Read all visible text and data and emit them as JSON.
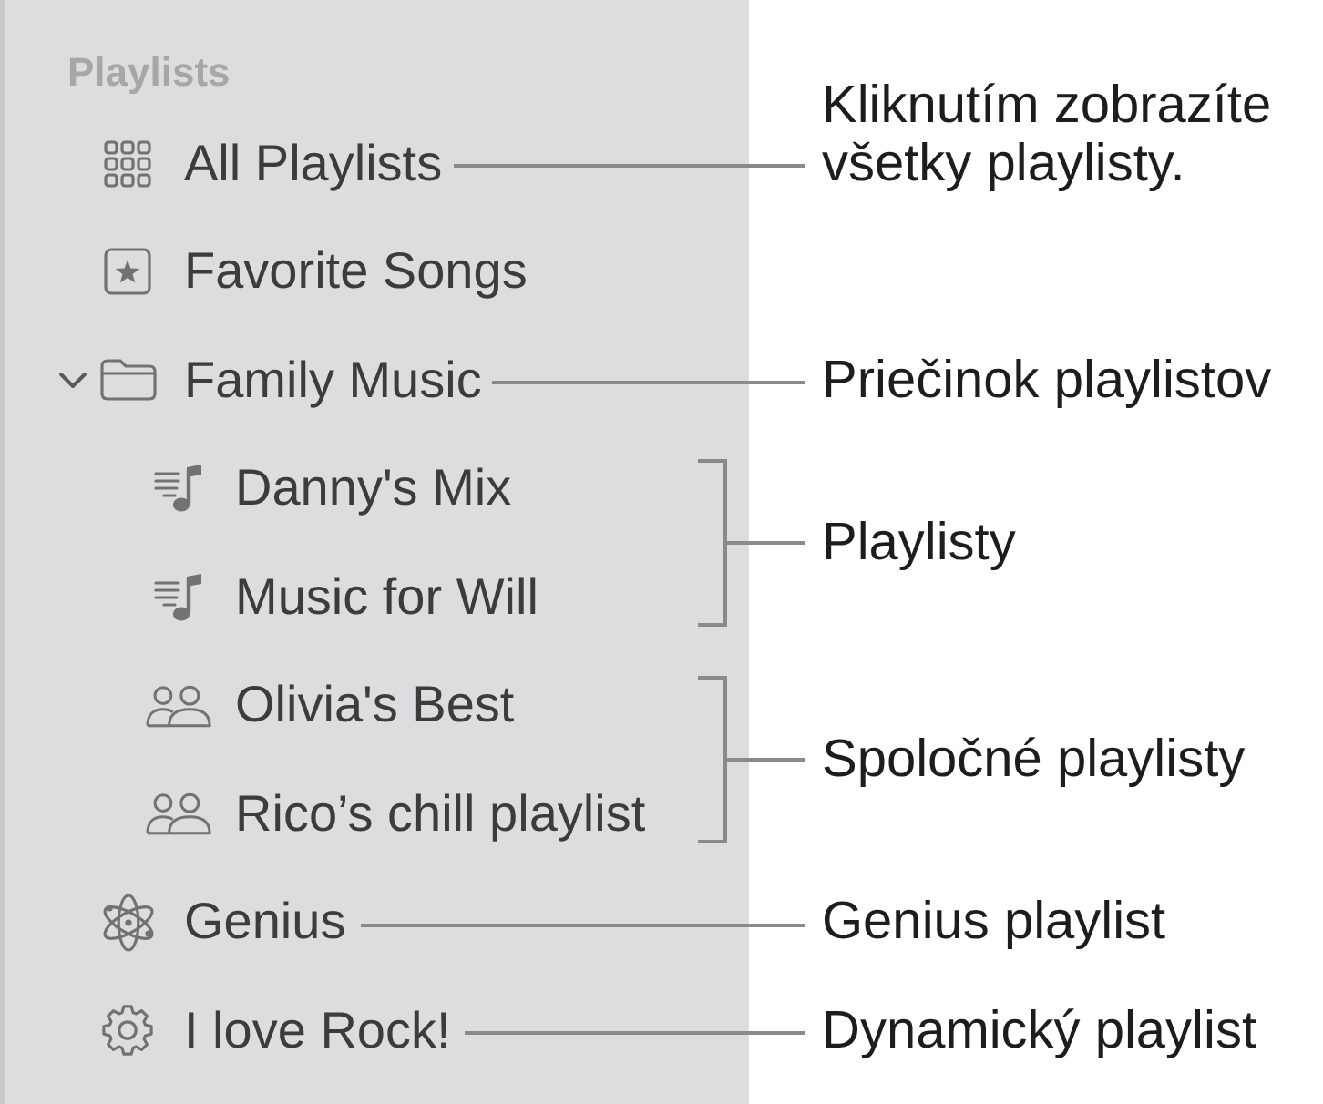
{
  "sidebar": {
    "header": "Playlists",
    "items": [
      {
        "kind": "all",
        "label": "All Playlists",
        "callout": {
          "kind": "line",
          "text": "Kliknutím zobrazíte všetky playlisty."
        }
      },
      {
        "kind": "favorites",
        "label": "Favorite Songs"
      },
      {
        "kind": "folder",
        "label": "Family Music",
        "expanded": true,
        "callout": {
          "kind": "line",
          "text": "Priečinok playlistov"
        },
        "children": [
          {
            "kind": "playlist",
            "label": "Danny's Mix",
            "callout": {
              "kind": "bracket",
              "text": "Playlisty"
            }
          },
          {
            "kind": "playlist",
            "label": "Music for Will"
          },
          {
            "kind": "shared",
            "label": "Olivia's Best",
            "callout": {
              "kind": "bracket",
              "text": "Spoločné playlisty"
            }
          },
          {
            "kind": "shared",
            "label": "Rico’s chill playlist"
          }
        ]
      },
      {
        "kind": "genius",
        "label": "Genius",
        "callout": {
          "kind": "line",
          "text": "Genius playlist"
        }
      },
      {
        "kind": "smart",
        "label": "I love Rock!",
        "callout": {
          "kind": "line",
          "text": "Dynamický playlist"
        }
      }
    ]
  }
}
